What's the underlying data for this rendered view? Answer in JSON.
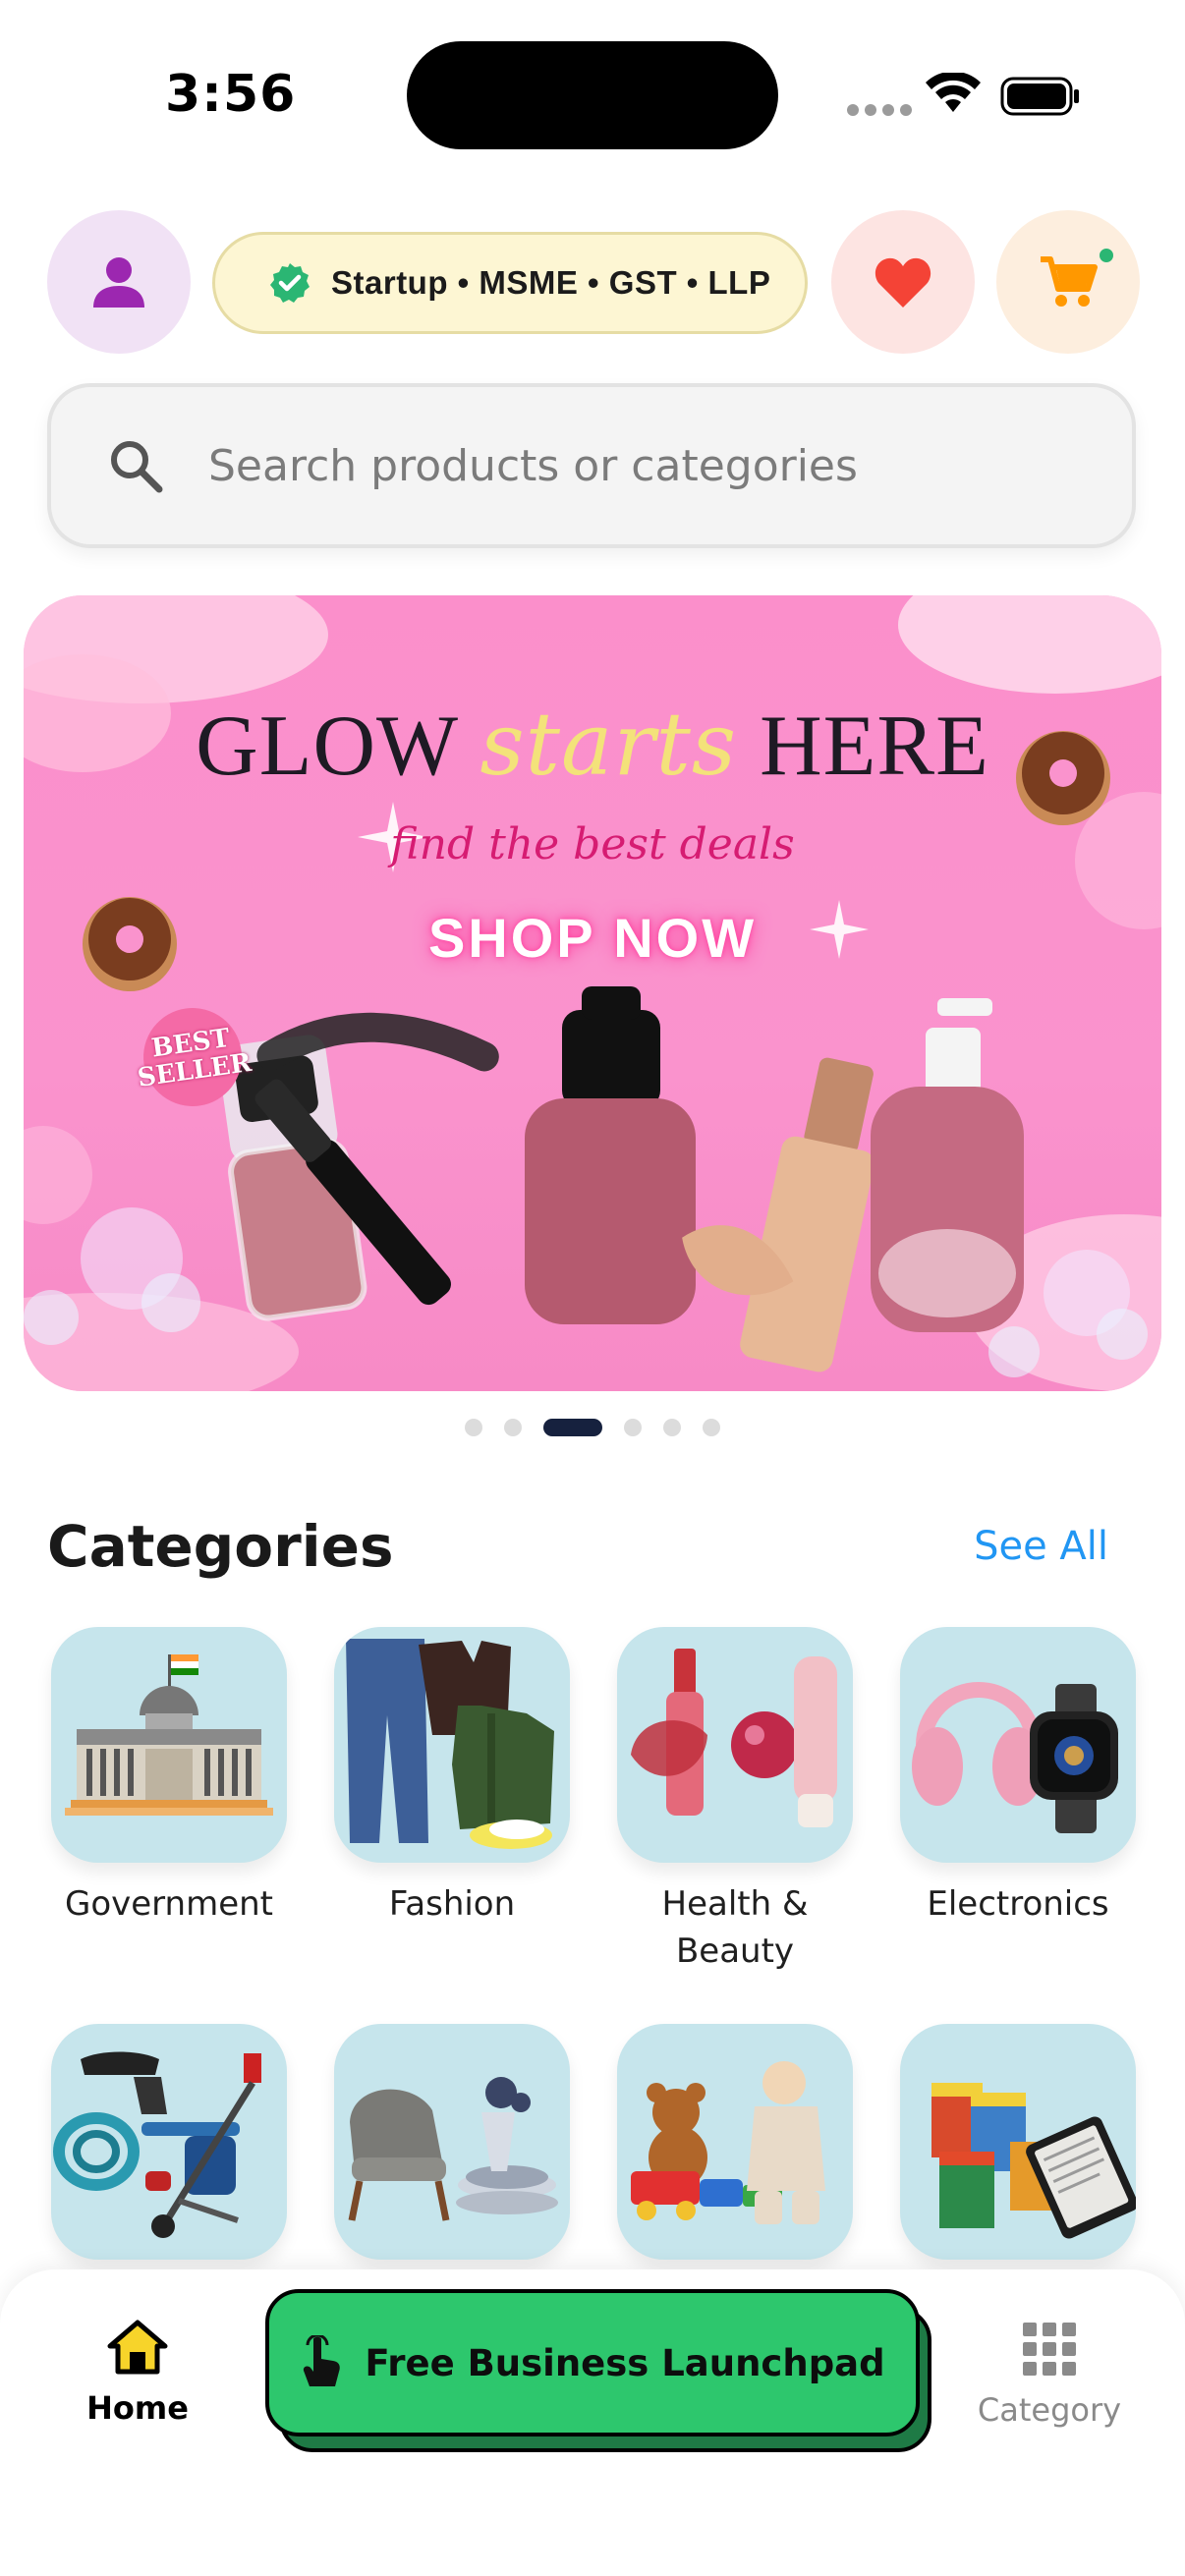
{
  "status_bar": {
    "time": "3:56"
  },
  "header": {
    "badge_text": "Startup • MSME • GST • LLP",
    "colors": {
      "profile": "#9c27b0",
      "favorite": "#f44336",
      "cart": "#ff9800",
      "cart_dot": "#2bb673",
      "badge_check": "#2bb673"
    }
  },
  "search": {
    "placeholder": "Search products or categories"
  },
  "banner": {
    "title_pre": "GLOW ",
    "title_accent": "starts",
    "title_post": " HERE",
    "subtitle": "find the best deals",
    "cta": "SHOP NOW",
    "sticker_line1": "BEST",
    "sticker_line2": "SELLER"
  },
  "carousel": {
    "count": 6,
    "active_index": 2
  },
  "categories": {
    "title": "Categories",
    "see_all": "See All",
    "items": [
      {
        "label": "Government",
        "icon": "government-building-icon"
      },
      {
        "label": "Fashion",
        "icon": "fashion-icon"
      },
      {
        "label": "Health & Beauty",
        "icon": "cosmetics-icon"
      },
      {
        "label": "Electronics",
        "icon": "electronics-icon"
      },
      {
        "label": "",
        "icon": "tools-equipment-icon"
      },
      {
        "label": "",
        "icon": "furniture-icon"
      },
      {
        "label": "",
        "icon": "toys-icon"
      },
      {
        "label": "",
        "icon": "books-icon"
      }
    ]
  },
  "bottom_nav": {
    "home": "Home",
    "launchpad": "Free Business Launchpad",
    "category": "Category"
  }
}
